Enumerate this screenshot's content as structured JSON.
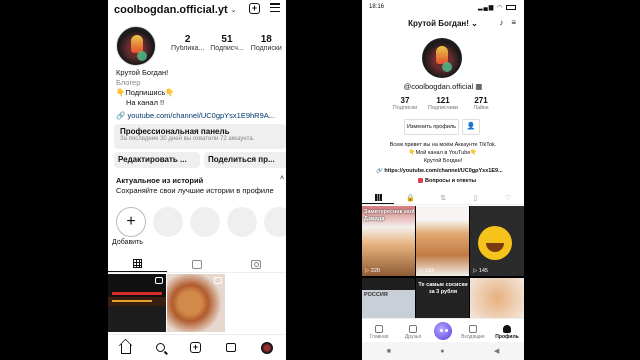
{
  "instagram": {
    "username": "coolbogdan.official.yt",
    "stats": [
      {
        "count": "2",
        "label": "Публика..."
      },
      {
        "count": "51",
        "label": "Подписч..."
      },
      {
        "count": "18",
        "label": "Подписки"
      }
    ],
    "bio": {
      "name": "Крутой Богдан!",
      "category": "Блогер",
      "line1": "👇Подпишись👇",
      "line2": "На канал !!",
      "link": "youtube.com/channel/UC0gpYsx1E9hR9A..."
    },
    "pro_panel": {
      "title": "Профессиональная панель",
      "subtitle": "За последние 30 дней вы охватили 72 аккаунта."
    },
    "buttons": {
      "edit": "Редактировать ...",
      "share": "Поделиться пр..."
    },
    "highlights": {
      "title": "Актуальное из историй",
      "subtitle": "Сохраняйте свои лучшие истории в профиле",
      "add_label": "Добавить"
    }
  },
  "tiktok": {
    "status_time": "18:16",
    "title": "Крутой Богдан!",
    "handle": "@coolbogdan.official",
    "stats": [
      {
        "count": "37",
        "label": "Подписки"
      },
      {
        "count": "121",
        "label": "Подписчики"
      },
      {
        "count": "271",
        "label": "Лайки"
      }
    ],
    "edit_button": "Изменить профиль",
    "bio": {
      "line1": "Всем привет вы на моём Аккаунте TikTok.",
      "line2": "👇Мой канал в YouTube👇",
      "line3": "Крутой Богдан!",
      "link": "https://youtube.com/channel/UC0gpYsx1E9...",
      "qa": "Вопросы и ответы"
    },
    "videos": [
      {
        "caption": "Замятересник мой Дэвида",
        "views": "220"
      },
      {
        "caption": "",
        "views": "143"
      },
      {
        "caption": "",
        "views": "145"
      },
      {
        "caption": "РОССИЯ",
        "views": ""
      },
      {
        "caption": "Те самые сосиски за 3 рубля",
        "views": ""
      },
      {
        "caption": "",
        "views": ""
      }
    ],
    "nav": {
      "home": "Главная",
      "friends": "Друзья",
      "inbox": "Входящие",
      "profile": "Профиль"
    }
  }
}
